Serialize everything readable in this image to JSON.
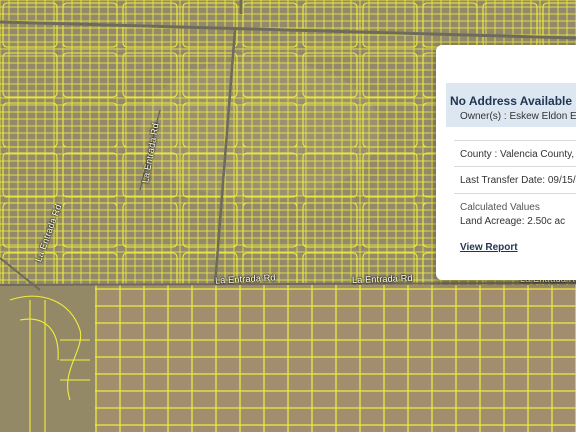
{
  "map": {
    "colors": {
      "terrain": "#9a8a6c",
      "parcel_line": "#f2ee3a",
      "road": "#6e6a5c"
    },
    "road_labels": [
      {
        "id": "la-entrada-1",
        "text": "La Entrada Rd"
      },
      {
        "id": "la-entrada-2",
        "text": "La Entrada Rd"
      },
      {
        "id": "la-entrada-3",
        "text": "La Entrada Rd"
      },
      {
        "id": "la-entrada-vertical",
        "text": "La Entrada Rd"
      },
      {
        "id": "la-entrada-diagonal",
        "text": "La Entrada Rd"
      }
    ]
  },
  "popup": {
    "title": "No Address Available",
    "owner_label": "Owner(s) :",
    "owner_value": "Eskew Eldon E",
    "county_label": "County :",
    "county_value": "Valencia County, N",
    "transfer_label": "Last Transfer Date:",
    "transfer_value": "09/15/",
    "calculated_title": "Calculated Values",
    "acreage_label": "Land Acreage:",
    "acreage_value": "2.50c ac",
    "report_link": "View Report"
  }
}
